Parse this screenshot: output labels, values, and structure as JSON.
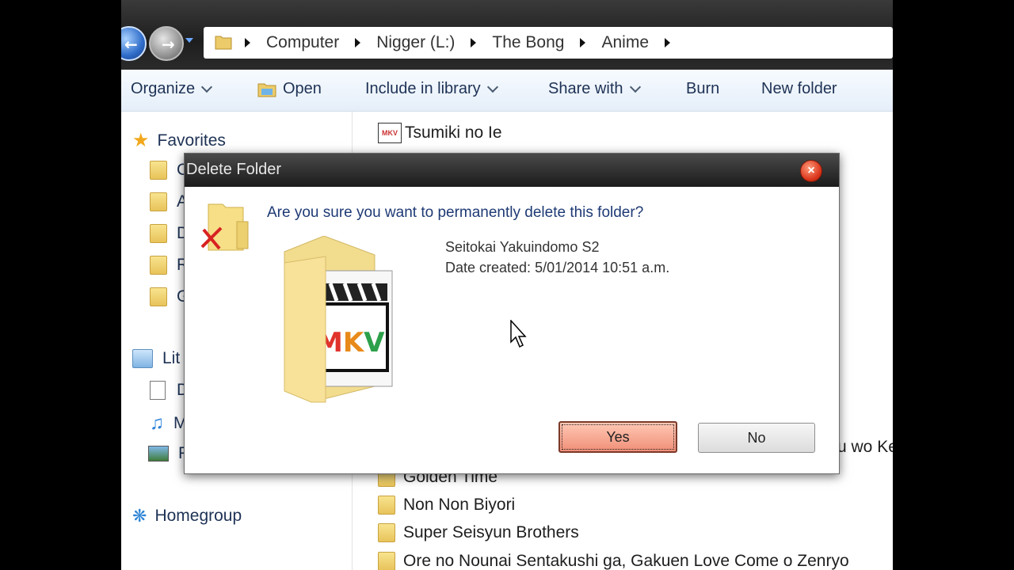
{
  "address": {
    "crumbs": [
      "Computer",
      "Nigger (L:)",
      "The Bong",
      "Anime"
    ]
  },
  "toolbar": {
    "organize": "Organize",
    "open": "Open",
    "include_in_library": "Include in library",
    "share_with": "Share with",
    "burn": "Burn",
    "new_folder": "New folder"
  },
  "sidebar": {
    "favorites": "Favorites",
    "fav_items": [
      "C",
      "A",
      "D",
      "R",
      "G"
    ],
    "libraries": "Lit",
    "lib_items": [
      "D",
      "M",
      "P"
    ],
    "homegroup": "Homegroup"
  },
  "files": {
    "top_item": "Tsumiki no Ie",
    "partial_right": "u wo Ke",
    "items": [
      "Golden Time",
      "Non Non Biyori",
      "Super Seisyun Brothers",
      "Ore no Nounai Sentakushi ga, Gakuen Love Come o Zenryo"
    ]
  },
  "dialog": {
    "title": "Delete Folder",
    "question": "Are you sure you want to permanently delete this folder?",
    "folder_name": "Seitokai Yakuindomo S2",
    "date_created": "Date created: 5/01/2014 10:51 a.m.",
    "yes": "Yes",
    "no": "No",
    "thumbnail_text": "MKV"
  },
  "colors": {
    "accent": "#1e3a75",
    "yes_button": "#f3a08a",
    "close_button": "#d9341a"
  }
}
